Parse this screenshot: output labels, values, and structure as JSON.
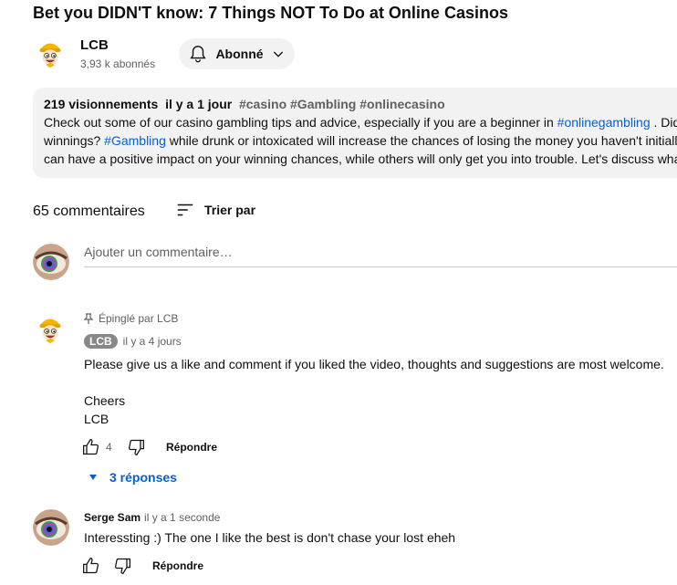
{
  "video": {
    "title": "Bet you DIDN'T know: 7 Things NOT To Do at Online Casinos"
  },
  "channel": {
    "name": "LCB",
    "subscribers": "3,93 k abonnés",
    "subscribe_label": "Abonné"
  },
  "description": {
    "views": "219 visionnements",
    "age": "il y a 1 jour",
    "tags": [
      "#casino",
      "#Gambling",
      "#onlinecasino"
    ],
    "line1_text": "Check out some of our casino gambling tips and advice, especially if you are a beginner in",
    "line1_link": "#onlinegambling",
    "line1_tail": " . Did",
    "line2_start": "winnings?",
    "line2_link": "#Gambling",
    "line2_text": " while drunk or intoxicated will increase the chances of losing the money you haven't initiall",
    "line3_text": "can have a positive impact on your winning chances, while others will only get you into trouble. Let's discuss wha"
  },
  "comments_header": {
    "count": "65 commentaires",
    "sort_label": "Trier par"
  },
  "add_comment": {
    "placeholder": "Ajouter un commentaire…"
  },
  "comments": [
    {
      "pinned": "Épinglé par LCB",
      "author": "LCB",
      "time": "il y a 4 jours",
      "lines": [
        "Please give us a like and comment if you liked the video, thoughts and suggestions are most welcome.",
        "Cheers",
        "LCB"
      ],
      "likes": "4",
      "reply_label": "Répondre",
      "replies_label": "3 réponses"
    },
    {
      "author": "Serge Sam",
      "time": "il y a 1 seconde",
      "lines": [
        "Interessting :) The one I like the best is don't chase your lost eheh"
      ],
      "likes": "",
      "reply_label": "Répondre"
    }
  ]
}
